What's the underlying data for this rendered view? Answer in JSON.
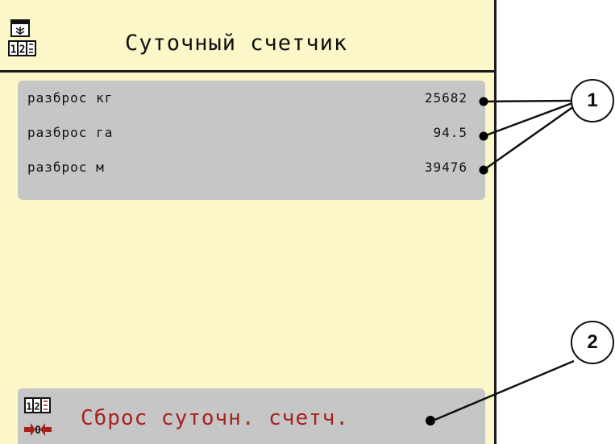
{
  "header": {
    "title": "Суточный счетчик",
    "icon": "daily-counter-icon",
    "icon_digits": "12"
  },
  "counters": [
    {
      "label": "разброс кг",
      "value": "25682"
    },
    {
      "label": "разброс га",
      "value": "94.5"
    },
    {
      "label": "разброс м",
      "value": "39476"
    }
  ],
  "reset": {
    "label": "Сброс суточн. счетч.",
    "icon": "reset-counter-icon",
    "icon_digits": "12",
    "icon_zero": "0"
  },
  "callouts": [
    {
      "number": "1"
    },
    {
      "number": "2"
    }
  ],
  "colors": {
    "screen_bg": "#fbf7c9",
    "panel_bg": "#c6c6c6",
    "accent": "#a4221f"
  }
}
